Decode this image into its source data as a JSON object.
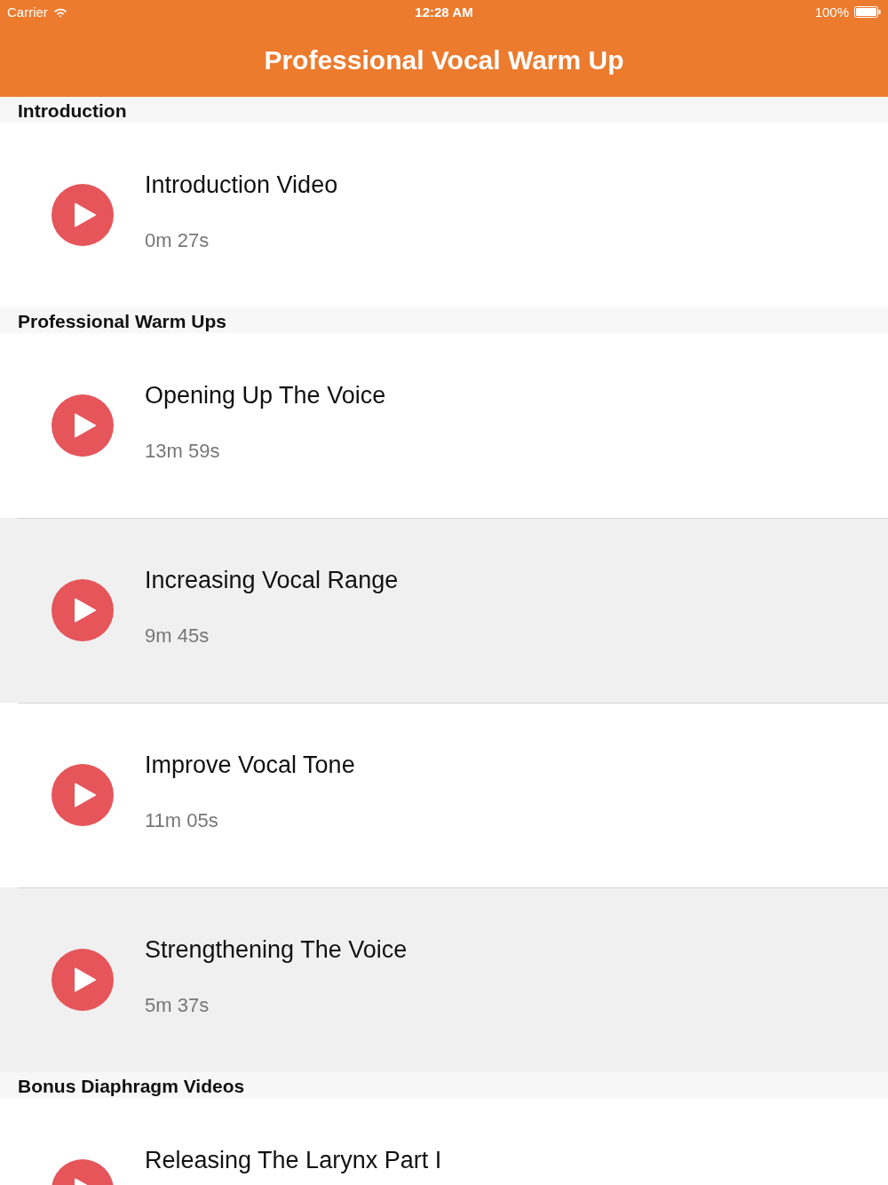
{
  "status_bar": {
    "carrier": "Carrier",
    "time": "12:28 AM",
    "battery": "100%"
  },
  "nav_bar": {
    "title": "Professional Vocal Warm Up"
  },
  "sections": [
    {
      "title": "Introduction",
      "items": [
        {
          "title": "Introduction Video",
          "duration": "0m 27s",
          "highlighted": false
        }
      ]
    },
    {
      "title": "Professional Warm Ups",
      "items": [
        {
          "title": "Opening Up The Voice",
          "duration": "13m 59s",
          "highlighted": false
        },
        {
          "title": "Increasing Vocal Range",
          "duration": "9m 45s",
          "highlighted": true
        },
        {
          "title": "Improve Vocal Tone",
          "duration": "11m 05s",
          "highlighted": false
        },
        {
          "title": "Strengthening The Voice",
          "duration": "5m 37s",
          "highlighted": true
        }
      ]
    },
    {
      "title": "Bonus Diaphragm Videos",
      "items": [
        {
          "title": "Releasing The Larynx Part I",
          "highlighted": false
        }
      ]
    }
  ]
}
